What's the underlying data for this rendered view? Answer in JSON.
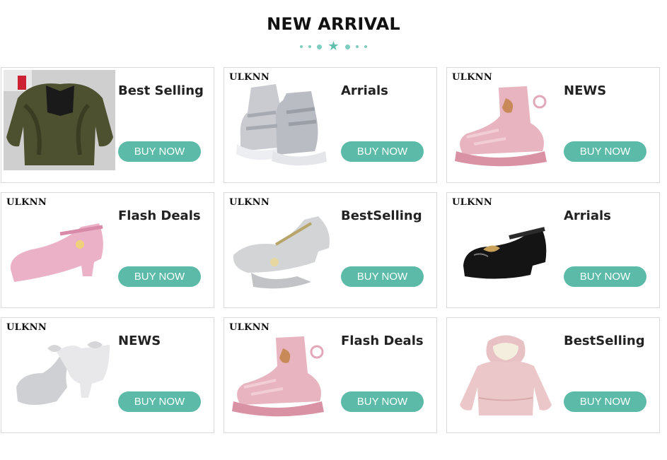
{
  "header": {
    "title": "NEW ARRIVAL"
  },
  "accent_color": "#5cbba8",
  "cards": [
    {
      "brand": "",
      "label": "Best Selling",
      "button": "BUY NOW",
      "image": "fur-jacket-photo"
    },
    {
      "brand": "ULKNN",
      "label": "Arrials",
      "button": "BUY NOW",
      "image": "silver-snow-boots"
    },
    {
      "brand": "ULKNN",
      "label": "NEWS",
      "button": "BUY NOW",
      "image": "pink-snow-boot"
    },
    {
      "brand": "ULKNN",
      "label": "Flash Deals",
      "button": "BUY NOW",
      "image": "pink-glitter-heel"
    },
    {
      "brand": "ULKNN",
      "label": "BestSelling",
      "button": "BUY NOW",
      "image": "silver-glitter-shoes"
    },
    {
      "brand": "ULKNN",
      "label": "Arrials",
      "button": "BUY NOW",
      "image": "black-patent-shoe"
    },
    {
      "brand": "ULKNN",
      "label": "NEWS",
      "button": "BUY NOW",
      "image": "silver-bow-sandals"
    },
    {
      "brand": "ULKNN",
      "label": "Flash Deals",
      "button": "BUY NOW",
      "image": "pink-snow-boot"
    },
    {
      "brand": "",
      "label": "BestSelling",
      "button": "BUY NOW",
      "image": "pink-fur-coat"
    }
  ]
}
